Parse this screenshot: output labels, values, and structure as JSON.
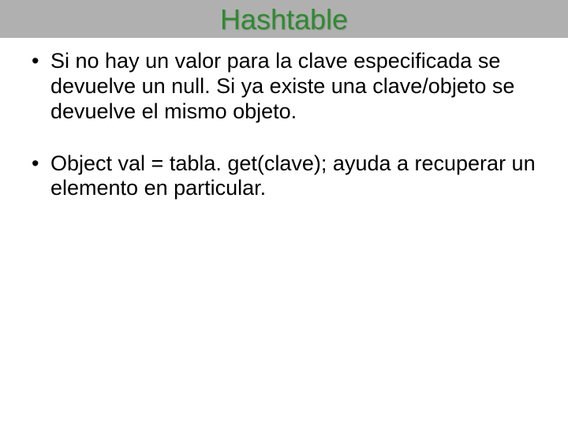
{
  "slide": {
    "title": "Hashtable",
    "bullets": [
      "Si no hay un valor para la clave especificada se devuelve un null. Si ya existe una clave/objeto se devuelve el mismo objeto.",
      "Object val = tabla. get(clave); ayuda a recuperar un elemento en particular."
    ]
  }
}
